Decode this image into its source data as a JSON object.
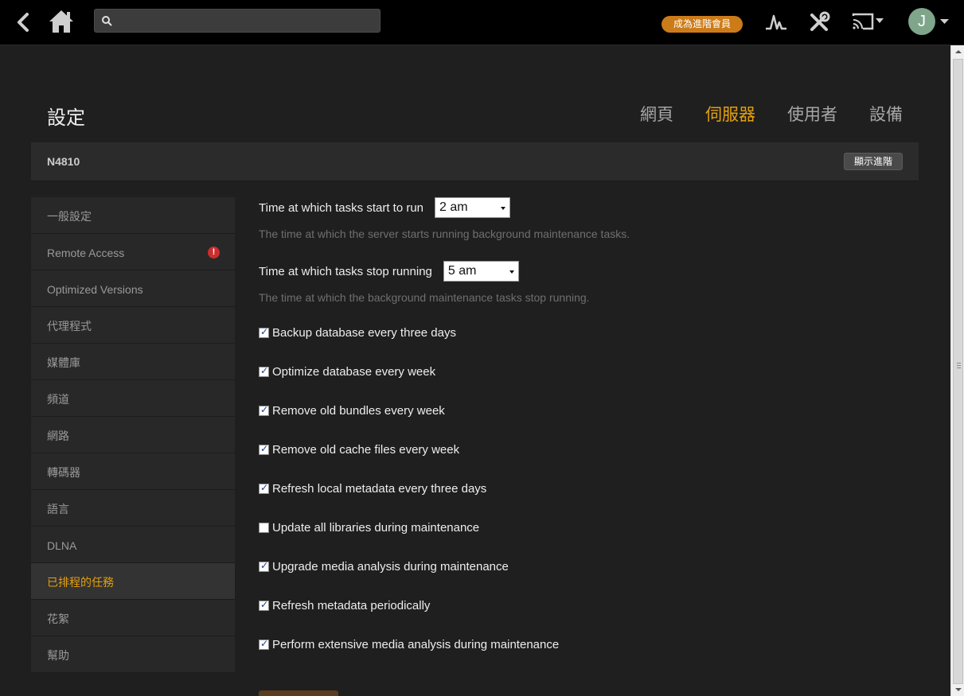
{
  "topbar": {
    "back_icon": "chevron-left-icon",
    "home_icon": "home-icon",
    "search": {
      "value": "",
      "placeholder": ""
    },
    "premium_label": "成為進階會員",
    "activity_icon": "activity-icon",
    "settings_icon": "tools-icon",
    "cast_icon": "cast-icon",
    "avatar_letter": "J"
  },
  "header": {
    "title": "設定",
    "tabs": [
      {
        "label": "網頁",
        "active": false
      },
      {
        "label": "伺服器",
        "active": true
      },
      {
        "label": "使用者",
        "active": false
      },
      {
        "label": "設備",
        "active": false
      }
    ]
  },
  "server": {
    "name": "N4810",
    "advanced_button": "顯示進階"
  },
  "sidebar": {
    "items": [
      {
        "label": "一般設定"
      },
      {
        "label": "Remote Access",
        "warning": "!"
      },
      {
        "label": "Optimized Versions"
      },
      {
        "label": "代理程式"
      },
      {
        "label": "媒體庫"
      },
      {
        "label": "頻道"
      },
      {
        "label": "網路"
      },
      {
        "label": "轉碼器"
      },
      {
        "label": "語言"
      },
      {
        "label": "DLNA"
      },
      {
        "label": "已排程的任務",
        "active": true
      },
      {
        "label": "花絮"
      },
      {
        "label": "幫助"
      }
    ]
  },
  "content": {
    "start": {
      "label": "Time at which tasks start to run",
      "value": "2 am",
      "help": "The time at which the server starts running background maintenance tasks."
    },
    "stop": {
      "label": "Time at which tasks stop running",
      "value": "5 am",
      "help": "The time at which the background maintenance tasks stop running."
    },
    "checkboxes": [
      {
        "label": "Backup database every three days",
        "checked": true
      },
      {
        "label": "Optimize database every week",
        "checked": true
      },
      {
        "label": "Remove old bundles every week",
        "checked": true
      },
      {
        "label": "Remove old cache files every week",
        "checked": true
      },
      {
        "label": "Refresh local metadata every three days",
        "checked": true
      },
      {
        "label": "Update all libraries during maintenance",
        "checked": false
      },
      {
        "label": "Upgrade media analysis during maintenance",
        "checked": true
      },
      {
        "label": "Refresh metadata periodically",
        "checked": true
      },
      {
        "label": "Perform extensive media analysis during maintenance",
        "checked": true
      }
    ]
  },
  "colors": {
    "accent": "#e5a00d",
    "topbar": "#000000",
    "background": "#1f1f1f",
    "premium_badge": "#cc7b19",
    "warning": "#cc2d2d",
    "avatar": "#7fa58a"
  }
}
